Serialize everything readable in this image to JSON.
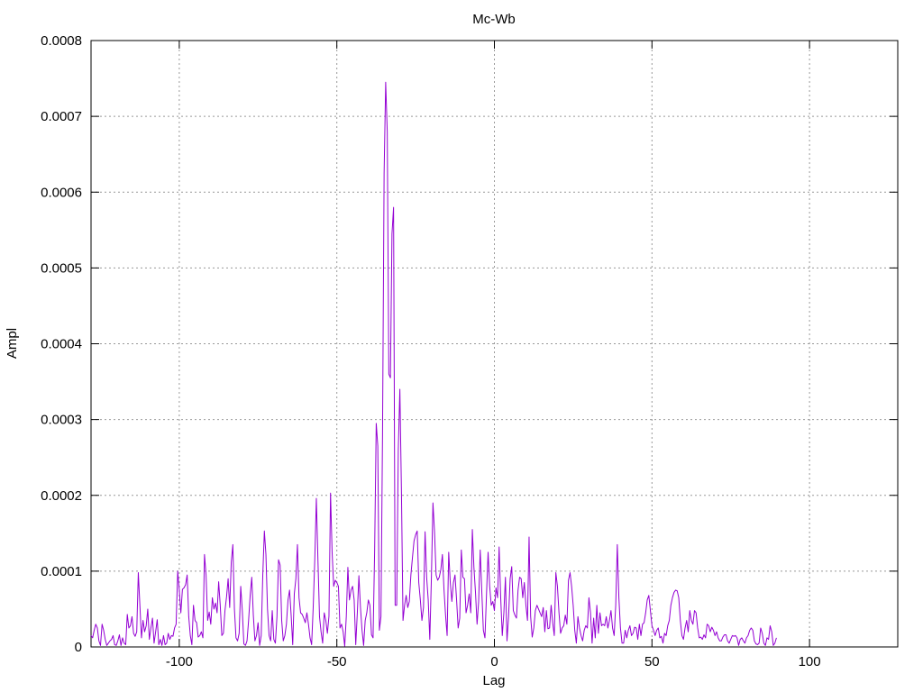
{
  "chart_data": {
    "type": "line",
    "title": "Mc-Wb",
    "xlabel": "Lag",
    "ylabel": "Ampl",
    "xlim": [
      -128,
      128
    ],
    "ylim": [
      0,
      0.0008
    ],
    "grid": true,
    "x_ticks": [
      -100,
      -50,
      0,
      50,
      100
    ],
    "x_tick_labels": [
      "-100",
      "-50",
      "0",
      "50",
      "100"
    ],
    "y_ticks": [
      0,
      0.0001,
      0.0002,
      0.0003,
      0.0004,
      0.0005,
      0.0006,
      0.0007,
      0.0008
    ],
    "y_tick_labels": [
      "0",
      "0.0001",
      "0.0002",
      "0.0003",
      "0.0004",
      "0.0005",
      "0.0006",
      "0.0007",
      "0.0008"
    ],
    "series": [
      {
        "color": "#9400d3",
        "x_start": -128,
        "x_step": 0.5,
        "values": [
          1.5e-05,
          1.2e-05,
          2.2e-05,
          3e-05,
          2.5e-05,
          8e-06,
          2e-06,
          3e-05,
          2.2e-05,
          1e-05,
          2e-06,
          5e-06,
          8e-06,
          1e-05,
          1.5e-05,
          3e-06,
          2e-06,
          8e-06,
          1.6e-05,
          2e-06,
          1.2e-05,
          5e-06,
          3e-06,
          4.3e-05,
          2.5e-05,
          2.8e-05,
          4e-05,
          1.8e-05,
          1.4e-05,
          2e-05,
          9.8e-05,
          5.5e-05,
          1.2e-05,
          3.5e-05,
          2e-05,
          2.8e-05,
          5e-05,
          1e-05,
          2.5e-05,
          3.8e-05,
          5e-06,
          2e-05,
          3.6e-05,
          3e-06,
          1e-05,
          2e-06,
          1.5e-05,
          3e-06,
          5e-06,
          1.8e-05,
          1e-05,
          1.5e-05,
          1.4e-05,
          2.5e-05,
          3e-05,
          0.0001,
          7.5e-05,
          4.5e-05,
          7.6e-05,
          7.8e-05,
          8.2e-05,
          9.5e-05,
          4e-05,
          1.5e-05,
          3e-06,
          5.5e-05,
          3.5e-05,
          3.2e-05,
          1.3e-05,
          1.5e-05,
          2e-05,
          1.2e-05,
          0.000122,
          9.5e-05,
          3.5e-05,
          4.6e-05,
          3e-05,
          6.5e-05,
          5e-05,
          5.8e-05,
          4.5e-05,
          8.6e-05,
          5.5e-05,
          1.5e-05,
          1.8e-05,
          4.8e-05,
          6.6e-05,
          9e-05,
          5.2e-05,
          0.000112,
          0.000135,
          5e-05,
          1.2e-05,
          8e-06,
          1.8e-05,
          8e-05,
          4.8e-05,
          4e-06,
          2e-06,
          8e-06,
          3.5e-05,
          6.8e-05,
          9.2e-05,
          4.2e-05,
          8e-06,
          1.5e-05,
          3.2e-05,
          2e-06,
          1.5e-05,
          9.5e-05,
          0.000153,
          0.000122,
          5e-05,
          1.5e-05,
          8e-06,
          4.8e-05,
          1e-05,
          5e-06,
          4e-05,
          0.000115,
          0.000108,
          3.5e-05,
          8e-06,
          1.5e-05,
          3e-05,
          6.2e-05,
          7.5e-05,
          4.2e-05,
          3e-06,
          7e-05,
          9e-05,
          0.000135,
          6.5e-05,
          4.5e-05,
          4.3e-05,
          3.8e-05,
          3.2e-05,
          4.5e-05,
          3e-05,
          1.2e-05,
          3e-06,
          5.2e-05,
          0.000115,
          0.000196,
          0.000115,
          4e-05,
          2e-05,
          5e-06,
          4.5e-05,
          3.5e-05,
          1.8e-05,
          4.05e-05,
          0.000203,
          0.000125,
          8e-05,
          8.8e-05,
          8.5e-05,
          8e-05,
          2.5e-05,
          3e-05,
          2e-05,
          1e-06,
          4e-05,
          0.000105,
          6.2e-05,
          7.5e-05,
          8e-05,
          6.2e-05,
          3e-06,
          4.5e-05,
          9.4e-05,
          5.2e-05,
          2.2e-05,
          2e-06,
          3.5e-05,
          4.5e-05,
          6.2e-05,
          5.5e-05,
          1.6e-05,
          1.2e-05,
          0.000128,
          0.000295,
          0.000265,
          2.2e-05,
          4e-05,
          0.00028,
          0.000625,
          0.000745,
          0.00068,
          0.00036,
          0.000355,
          0.000545,
          0.00058,
          5.5e-05,
          5.5e-05,
          0.00026,
          0.00034,
          0.000205,
          3.5e-05,
          5.5e-05,
          6.8e-05,
          5.2e-05,
          6e-05,
          9.5e-05,
          0.000118,
          0.00014,
          0.000148,
          0.000153,
          8.5e-05,
          6.2e-05,
          3.5e-05,
          5.2e-05,
          0.000152,
          9.2e-05,
          6.2e-05,
          1e-05,
          9e-05,
          0.00019,
          0.000152,
          9.5e-05,
          8.8e-05,
          9.2e-05,
          0.000102,
          0.000122,
          7.6e-05,
          4.2e-05,
          1.5e-05,
          0.000125,
          8.5e-05,
          6e-05,
          8.5e-05,
          9.5e-05,
          6.2e-05,
          2.5e-05,
          3.8e-05,
          0.000128,
          9.2e-05,
          9e-05,
          4.5e-05,
          5.5e-05,
          7e-05,
          4.5e-05,
          0.000155,
          0.000105,
          7.2e-05,
          3e-05,
          6e-05,
          0.000128,
          7.3e-05,
          2.2e-05,
          1.2e-05,
          7e-05,
          0.000125,
          8e-05,
          5.5e-05,
          6e-05,
          4.8e-05,
          7.8e-05,
          6.5e-05,
          0.000132,
          6.5e-05,
          1.5e-05,
          4.5e-05,
          9.2e-05,
          8e-06,
          4e-05,
          9e-05,
          0.000106,
          4.8e-05,
          4.2e-05,
          3.8e-05,
          7.5e-05,
          9.2e-05,
          9e-05,
          6.5e-05,
          8.5e-05,
          5.5e-05,
          3.5e-05,
          0.000145,
          4e-05,
          1.3e-05,
          2.5e-05,
          4.8e-05,
          5.5e-05,
          5e-05,
          4.5e-05,
          4e-05,
          5.2e-05,
          2e-05,
          4.8e-05,
          2.4e-05,
          2.5e-05,
          5.5e-05,
          3.2e-05,
          1.5e-05,
          9.8e-05,
          8e-05,
          4.5e-05,
          1.8e-05,
          2.5e-05,
          2.8e-05,
          4.2e-05,
          3e-05,
          8.8e-05,
          9.8e-05,
          8e-05,
          5.5e-05,
          2.2e-05,
          5e-06,
          4e-05,
          2.5e-05,
          1.5e-05,
          8e-06,
          2.2e-05,
          2.8e-05,
          2.5e-05,
          6.5e-05,
          4.5e-05,
          5e-06,
          3.8e-05,
          1.2e-05,
          5.5e-05,
          1.8e-05,
          4.5e-05,
          2.8e-05,
          3e-05,
          2.8e-05,
          4e-05,
          2.5e-05,
          3.5e-05,
          4.8e-05,
          2.5e-05,
          1.5e-05,
          5.5e-05,
          0.000135,
          6.5e-05,
          2.5e-05,
          5e-06,
          5e-06,
          2.2e-05,
          1.2e-05,
          2.2e-05,
          2.8e-05,
          1.5e-05,
          1.8e-05,
          2.6e-05,
          2.5e-05,
          1e-05,
          3e-05,
          1.5e-05,
          3e-05,
          3.2e-05,
          4.5e-05,
          6.2e-05,
          6.8e-05,
          4.8e-05,
          2.8e-05,
          2.2e-05,
          1.5e-05,
          2.2e-05,
          2.5e-05,
          1.2e-05,
          1.4e-05,
          5e-06,
          1.8e-05,
          1.5e-05,
          2.8e-05,
          3.5e-05,
          5.5e-05,
          6.5e-05,
          7.2e-05,
          7.5e-05,
          7.4e-05,
          6.5e-05,
          3.5e-05,
          1.5e-05,
          1e-05,
          2.5e-05,
          3.5e-05,
          2e-05,
          4.8e-05,
          3.5e-05,
          3e-05,
          4.8e-05,
          4.5e-05,
          2.5e-05,
          1.2e-05,
          1.3e-05,
          1e-05,
          1.6e-05,
          1.2e-05,
          3e-05,
          2.8e-05,
          2e-05,
          2.6e-05,
          2.2e-05,
          1.5e-05,
          2e-05,
          1.2e-05,
          8e-06,
          8e-06,
          1.3e-05,
          1.6e-05,
          1.6e-05,
          8e-06,
          5e-06,
          1e-05,
          1.5e-05,
          1.4e-05,
          1.5e-05,
          1.2e-05,
          2e-06,
          1e-05,
          1.2e-05,
          8e-06,
          5e-06,
          1.2e-05,
          1.5e-05,
          2.2e-05,
          2.5e-05,
          2.2e-05,
          8e-06,
          4e-06,
          3e-06,
          5e-06,
          2.5e-05,
          1.8e-05,
          5e-06,
          2e-06,
          1.2e-05,
          1e-05,
          2.8e-05,
          2e-05,
          2e-06,
          5e-06,
          1.2e-05
        ]
      }
    ]
  }
}
